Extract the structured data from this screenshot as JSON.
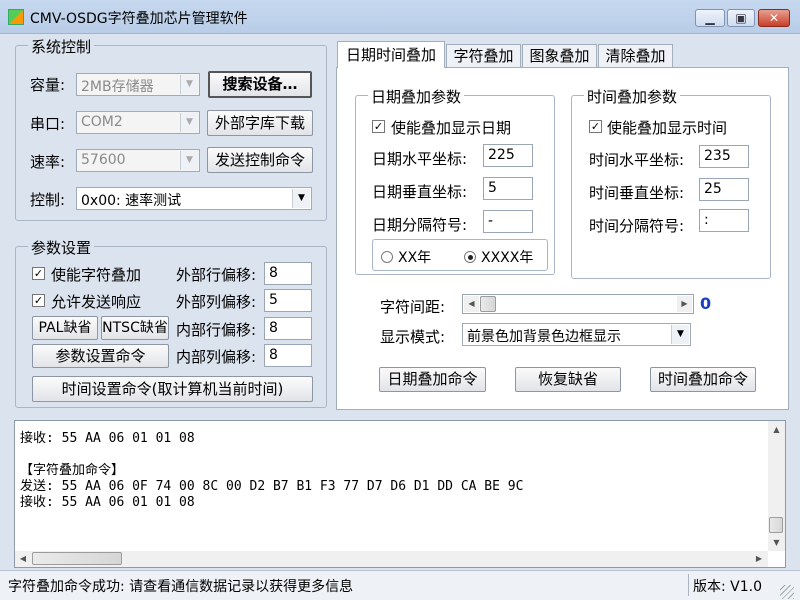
{
  "window": {
    "title": "CMV-OSDG字符叠加芯片管理软件"
  },
  "system": {
    "title": "系统控制",
    "capacity_label": "容量:",
    "capacity_value": "2MB存储器",
    "port_label": "串口:",
    "port_value": "COM2",
    "rate_label": "速率:",
    "rate_value": "57600",
    "control_label": "控制:",
    "control_value": "0x00: 速率测试",
    "search_button": "搜索设备…",
    "download_button": "外部字库下载",
    "send_control_button": "发送控制命令"
  },
  "params": {
    "title": "参数设置",
    "enable_overlay": "使能字符叠加",
    "allow_response": "允许发送响应",
    "ext_row_label": "外部行偏移:",
    "ext_row_value": "8",
    "ext_col_label": "外部列偏移:",
    "ext_col_value": "5",
    "int_row_label": "内部行偏移:",
    "int_row_value": "8",
    "int_col_label": "内部列偏移:",
    "int_col_value": "8",
    "pal_button": "PAL缺省",
    "ntsc_button": "NTSC缺省",
    "param_cmd_button": "参数设置命令",
    "time_cmd_button": "时间设置命令(取计算机当前时间)"
  },
  "tabs": [
    "日期时间叠加",
    "字符叠加",
    "图象叠加",
    "清除叠加"
  ],
  "date_group": {
    "title": "日期叠加参数",
    "enable": "使能叠加显示日期",
    "h_label": "日期水平坐标:",
    "h_value": "225",
    "v_label": "日期垂直坐标:",
    "v_value": "5",
    "sep_label": "日期分隔符号:",
    "sep_value": "-",
    "radio_a": "XX年",
    "radio_b": "XXXX年"
  },
  "time_group": {
    "title": "时间叠加参数",
    "enable": "使能叠加显示时间",
    "h_label": "时间水平坐标:",
    "h_value": "235",
    "v_label": "时间垂直坐标:",
    "v_value": "25",
    "sep_label": "时间分隔符号:",
    "sep_value": ":"
  },
  "spacing": {
    "label": "字符间距:",
    "value": "0"
  },
  "display_mode": {
    "label": "显示模式:",
    "value": "前景色加背景色边框显示"
  },
  "actions": {
    "date_cmd": "日期叠加命令",
    "restore": "恢复缺省",
    "time_cmd": "时间叠加命令"
  },
  "log_lines": [
    "接收: 55 AA 06 01 01 08",
    "",
    "【字符叠加命令】",
    "发送: 55 AA 06 0F 74 00 8C 00 D2 B7 B1 F3 77 D7 D6 D1 DD CA BE 9C",
    "接收: 55 AA 06 01 01 08"
  ],
  "status": {
    "message": "字符叠加命令成功: 请查看通信数据记录以获得更多信息",
    "version": "版本: V1.0"
  },
  "colors": {
    "accent": "#1a3fbf",
    "panel": "#dbe3ee"
  }
}
